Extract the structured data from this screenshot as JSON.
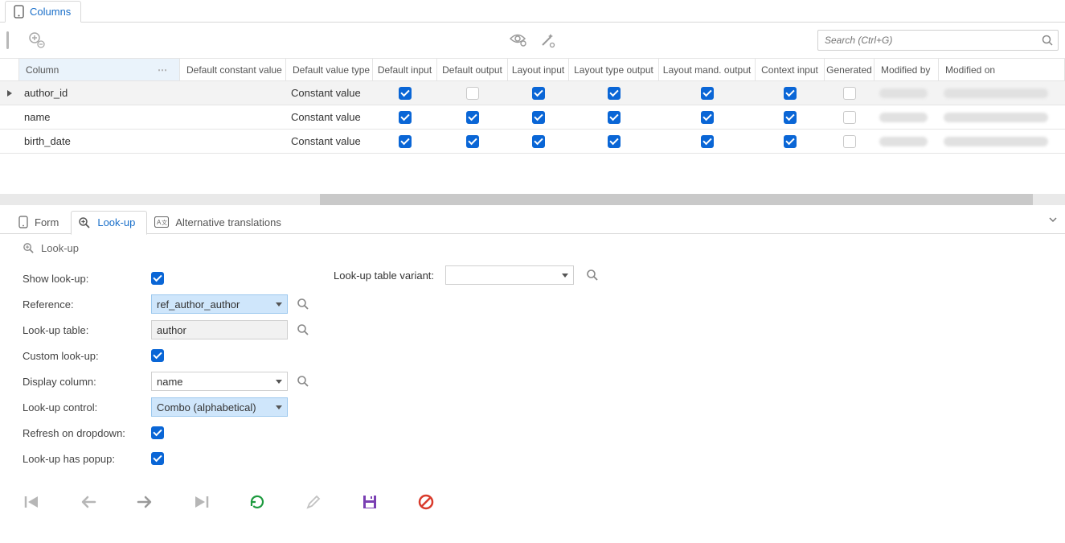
{
  "top_tab": {
    "label": "Columns"
  },
  "toolbar": {
    "search_placeholder": "Search (Ctrl+G)"
  },
  "grid": {
    "headers": {
      "column": "Column",
      "dcv": "Default constant value",
      "dvt": "Default value type",
      "di": "Default input",
      "do": "Default output",
      "li": "Layout input",
      "lto": "Layout type output",
      "lmo": "Layout mand. output",
      "ci": "Context input",
      "gen": "Generated",
      "modby": "Modified by",
      "modon": "Modified on"
    },
    "rows": [
      {
        "name": "author_id",
        "dvt": "Constant value",
        "di": true,
        "do": false,
        "li": true,
        "lto": true,
        "lmo": true,
        "ci": true,
        "gen": false,
        "selected": true
      },
      {
        "name": "name",
        "dvt": "Constant value",
        "di": true,
        "do": true,
        "li": true,
        "lto": true,
        "lmo": true,
        "ci": true,
        "gen": false,
        "selected": false
      },
      {
        "name": "birth_date",
        "dvt": "Constant value",
        "di": true,
        "do": true,
        "li": true,
        "lto": true,
        "lmo": true,
        "ci": true,
        "gen": false,
        "selected": false
      }
    ]
  },
  "mid_tabs": {
    "form": "Form",
    "lookup": "Look-up",
    "alt": "Alternative translations"
  },
  "variant": {
    "label": "Look-up table variant:",
    "value": ""
  },
  "lookup": {
    "section": "Look-up",
    "show_label": "Show look-up:",
    "show": true,
    "reference_label": "Reference:",
    "reference": "ref_author_author",
    "table_label": "Look-up table:",
    "table": "author",
    "custom_label": "Custom look-up:",
    "custom": true,
    "display_col_label": "Display column:",
    "display_col": "name",
    "control_label": "Look-up control:",
    "control": "Combo (alphabetical)",
    "refresh_label": "Refresh on dropdown:",
    "refresh": true,
    "popup_label": "Look-up has popup:",
    "popup": true
  }
}
